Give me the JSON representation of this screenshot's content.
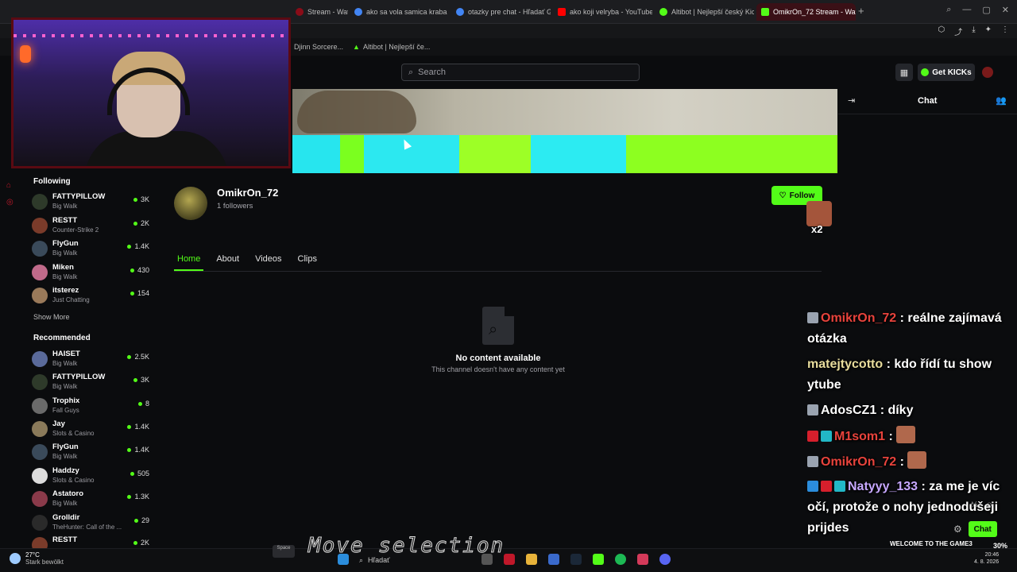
{
  "browser": {
    "tabs": [
      {
        "label": "Stream - Watc",
        "color": "#8a0c18"
      },
      {
        "label": "ako sa vola samica kraba",
        "color": "#4285f4"
      },
      {
        "label": "otazky pre chat - Hľadať G",
        "color": "#4285f4"
      },
      {
        "label": "ako koji velryba - YouTube",
        "color": "#ff0000"
      },
      {
        "label": "Altibot | Nejlepší český Kic",
        "color": "#53fc18"
      },
      {
        "label": "OmikrOn_72 Stream - Watc",
        "color": "#53fc18"
      }
    ],
    "bookmarks": [
      "Djinn Sorcere...",
      "Altibot | Nejlepší če..."
    ]
  },
  "header": {
    "search_placeholder": "Search",
    "get_kicks": "Get KICKs"
  },
  "sidebar": {
    "following_title": "Following",
    "following": [
      {
        "name": "FATTYPILLOW",
        "game": "Big Walk",
        "viewers": "3K"
      },
      {
        "name": "RESTT",
        "game": "Counter-Strike 2",
        "viewers": "2K"
      },
      {
        "name": "FlyGun",
        "game": "Big Walk",
        "viewers": "1.4K"
      },
      {
        "name": "Miken",
        "game": "Big Walk",
        "viewers": "430"
      },
      {
        "name": "itsterez",
        "game": "Just Chatting",
        "viewers": "154"
      }
    ],
    "show_more": "Show More",
    "recommended_title": "Recommended",
    "recommended": [
      {
        "name": "HAISET",
        "game": "Big Walk",
        "viewers": "2.5K"
      },
      {
        "name": "FATTYPILLOW",
        "game": "Big Walk",
        "viewers": "3K"
      },
      {
        "name": "Trophix",
        "game": "Fall Guys",
        "viewers": "8"
      },
      {
        "name": "Jay",
        "game": "Slots & Casino",
        "viewers": "1.4K"
      },
      {
        "name": "FlyGun",
        "game": "Big Walk",
        "viewers": "1.4K"
      },
      {
        "name": "Haddzy",
        "game": "Slots & Casino",
        "viewers": "505"
      },
      {
        "name": "Astatoro",
        "game": "Big Walk",
        "viewers": "1.3K"
      },
      {
        "name": "Grolldir",
        "game": "TheHunter: Call of the ...",
        "viewers": "29"
      },
      {
        "name": "RESTT",
        "game": "",
        "viewers": "2K"
      }
    ]
  },
  "channel": {
    "name": "OmikrOn_72",
    "followers": "1 followers",
    "follow_label": "Follow",
    "multiplier": "x2",
    "tabs": [
      "Home",
      "About",
      "Videos",
      "Clips"
    ],
    "active_tab": "Home",
    "empty_title": "No content available",
    "empty_subtitle": "This channel doesn't have any content yet"
  },
  "chat": {
    "title": "Chat",
    "send_label": "Chat",
    "messages": [
      {
        "user": "OmikrOn_72",
        "text": ": reálne zajímavá otázka"
      },
      {
        "user": "matejtycotto",
        "text": ": kdo řídí tu show ytube"
      },
      {
        "user": "AdosCZ1",
        "text": ": díky"
      },
      {
        "user": "M1som1",
        "text": ":"
      },
      {
        "user": "OmikrOn_72",
        "text": ":"
      },
      {
        "user": "Natyyy_133",
        "text": ": za me je víc očí, protože o nohy jednodušeji prijdes"
      }
    ],
    "overlay_banner": "WELCOME TO THE GAME3"
  },
  "taskbar": {
    "temp": "27°C",
    "weather": "Stark bewölkt",
    "search": "Hľadať",
    "time": "20:46",
    "date": "4. 8. 2026",
    "battery": "30%",
    "space_key": "Space"
  },
  "overlay_text": "Move selection"
}
